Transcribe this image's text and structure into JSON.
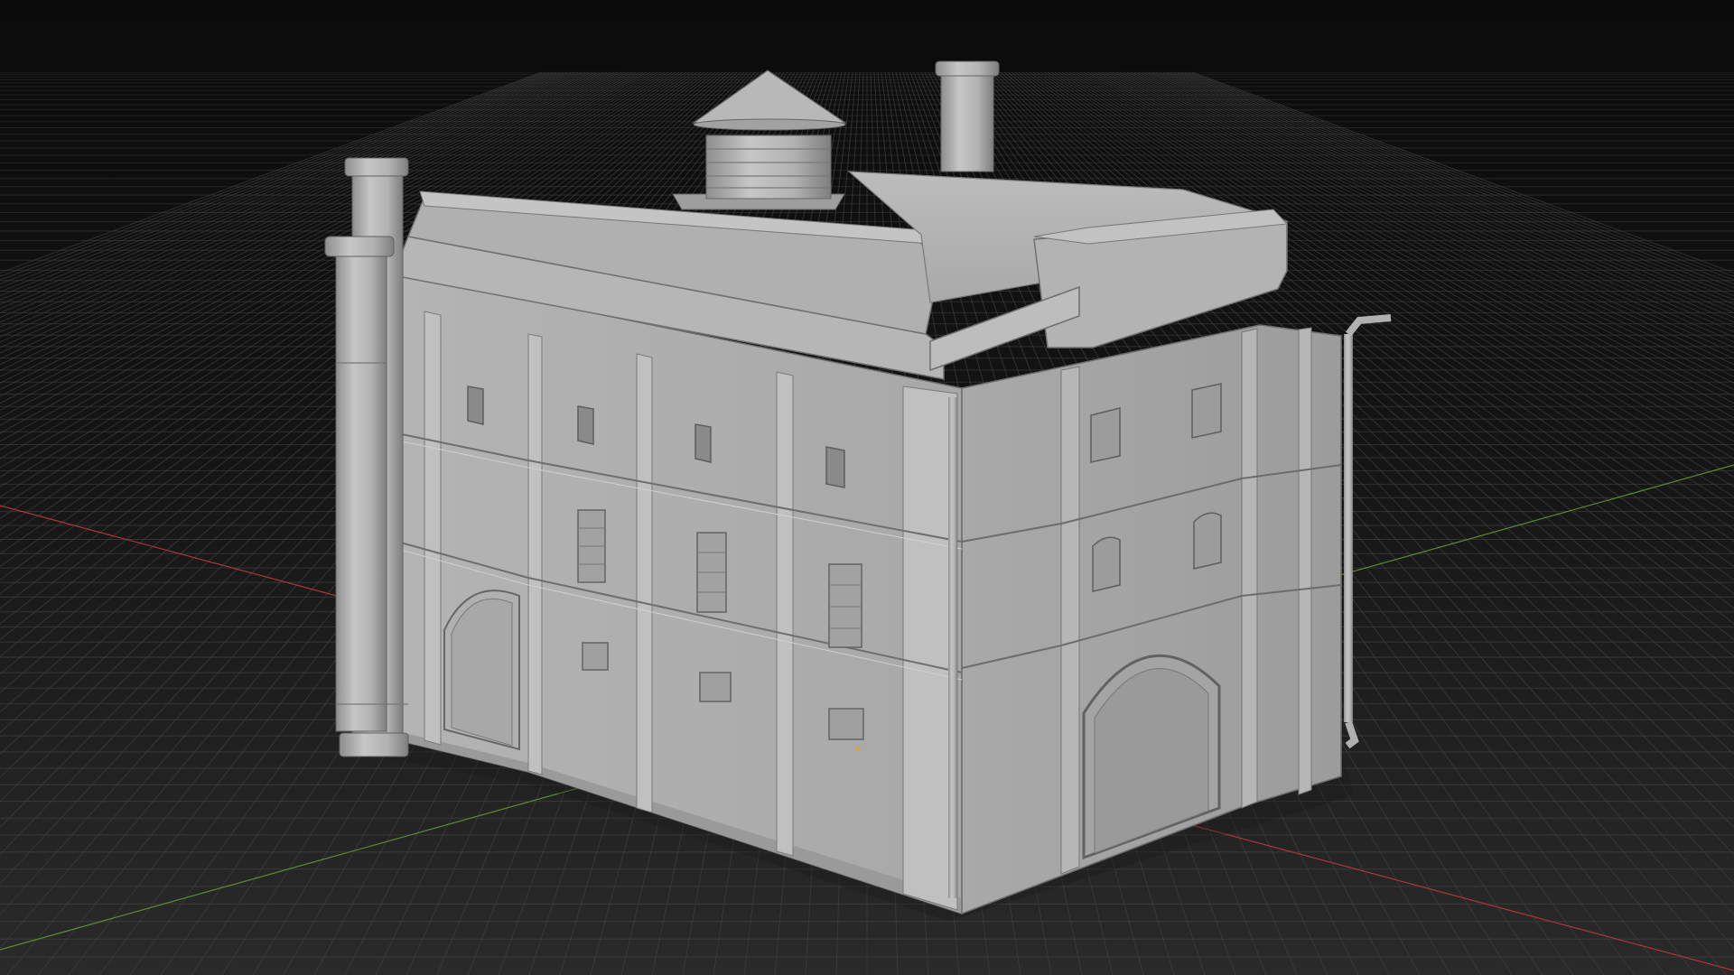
{
  "viewport": {
    "background_top": "#0d0d0d",
    "background_bottom": "#2c2c2c",
    "grid_color": "#4a4a4a",
    "axis_x_color": "#c23a3a",
    "axis_z_color": "#6f9a3c",
    "model_color": "#b9b9b9",
    "model": "building-mesh"
  }
}
